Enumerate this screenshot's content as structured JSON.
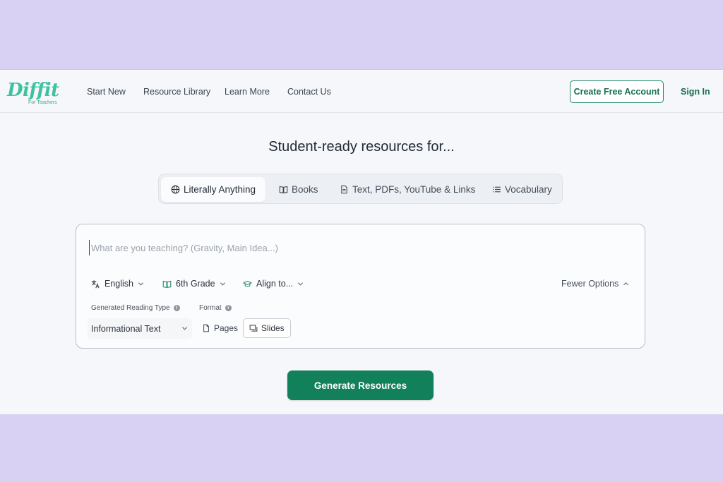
{
  "colors": {
    "page_background": "#d9d1f3",
    "app_background": "#f5f7fa",
    "brand_green": "#13805c",
    "logo_green": "#3fc1a0"
  },
  "nav": {
    "logo_text": "Diffit",
    "logo_tagline": "For Teachers",
    "links": [
      "Start New",
      "Resource Library",
      "Learn More",
      "Contact Us"
    ],
    "create_account_label": "Create Free Account",
    "sign_in_label": "Sign In"
  },
  "headline": "Student-ready resources for...",
  "tabs": [
    {
      "label": "Literally Anything",
      "icon": "globe-icon",
      "active": true
    },
    {
      "label": "Books",
      "icon": "book-icon",
      "active": false
    },
    {
      "label": "Text, PDFs, YouTube & Links",
      "icon": "document-icon",
      "active": false
    },
    {
      "label": "Vocabulary",
      "icon": "list-icon",
      "active": false
    }
  ],
  "form": {
    "topic_placeholder": "What are you teaching? (Gravity, Main Idea...)",
    "topic_value": "",
    "language": {
      "label": "English",
      "icon": "translate-icon"
    },
    "grade": {
      "label": "6th Grade",
      "icon": "open-book-icon"
    },
    "standards": {
      "label": "Align to...",
      "icon": "graduation-cap-icon"
    },
    "fewer_options_label": "Fewer Options",
    "reading_type_label": "Generated Reading Type",
    "reading_type_value": "Informational Text",
    "format_label": "Format",
    "format_options": [
      {
        "label": "Pages",
        "icon": "page-icon",
        "selected": false
      },
      {
        "label": "Slides",
        "icon": "slides-icon",
        "selected": true
      }
    ]
  },
  "generate_label": "Generate Resources"
}
